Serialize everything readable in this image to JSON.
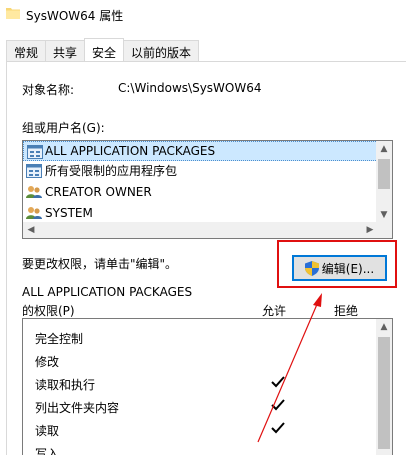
{
  "window": {
    "title": "SysWOW64 属性",
    "title_icon": "folder-icon"
  },
  "tabs": [
    {
      "label": "常规",
      "active": false
    },
    {
      "label": "共享",
      "active": false
    },
    {
      "label": "安全",
      "active": true
    },
    {
      "label": "以前的版本",
      "active": false
    }
  ],
  "object": {
    "label": "对象名称:",
    "value": "C:\\Windows\\SysWOW64"
  },
  "groups": {
    "label": "组或用户名(G):",
    "items": [
      {
        "label": "ALL APPLICATION PACKAGES",
        "icon": "app-packages-icon",
        "selected": true
      },
      {
        "label": "所有受限制的应用程序包",
        "icon": "app-packages-icon",
        "selected": false
      },
      {
        "label": "CREATOR OWNER",
        "icon": "users-icon",
        "selected": false
      },
      {
        "label": "SYSTEM",
        "icon": "users-icon",
        "selected": false
      }
    ]
  },
  "edit": {
    "hint": "要更改权限，请单击\"编辑\"。",
    "button_label": "编辑(E)...",
    "button_icon": "shield-icon"
  },
  "permissions": {
    "title_line1": "ALL APPLICATION PACKAGES",
    "title_line2": "的权限(P)",
    "allow_header": "允许",
    "deny_header": "拒绝",
    "rows": [
      {
        "name": "完全控制",
        "allow": false,
        "deny": false
      },
      {
        "name": "修改",
        "allow": false,
        "deny": false
      },
      {
        "name": "读取和执行",
        "allow": true,
        "deny": false
      },
      {
        "name": "列出文件夹内容",
        "allow": true,
        "deny": false
      },
      {
        "name": "读取",
        "allow": true,
        "deny": false
      },
      {
        "name": "写入",
        "allow": false,
        "deny": false
      }
    ]
  },
  "colors": {
    "highlight": "#e01010",
    "selection": "#cce8ff",
    "accent": "#0078d7"
  }
}
